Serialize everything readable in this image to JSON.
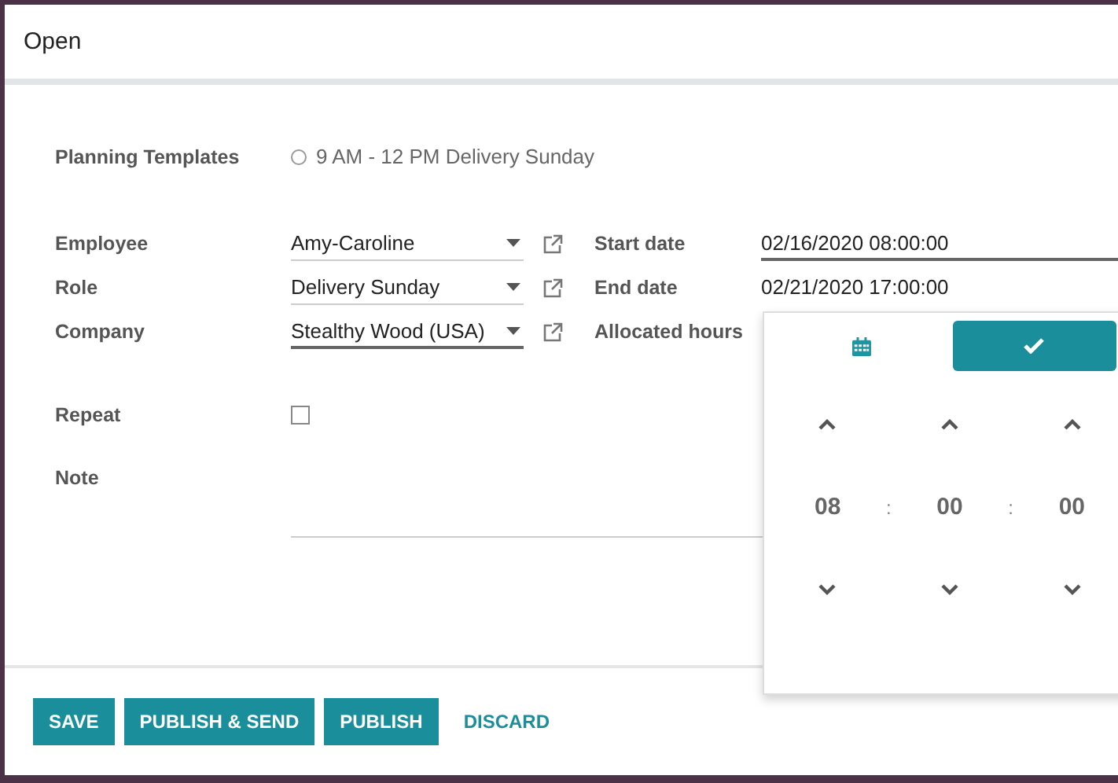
{
  "dialog": {
    "title": "Open"
  },
  "planning_templates": {
    "label": "Planning Templates",
    "options": [
      {
        "label": "9 AM - 12 PM Delivery Sunday",
        "selected": false
      }
    ]
  },
  "left_fields": [
    {
      "label": "Employee",
      "value": "Amy-Caroline",
      "focused": false
    },
    {
      "label": "Role",
      "value": "Delivery Sunday",
      "focused": false
    },
    {
      "label": "Company",
      "value": "Stealthy Wood (USA)",
      "focused": true
    }
  ],
  "right_fields": [
    {
      "label": "Start date",
      "value": "02/16/2020 08:00:00",
      "focused": true
    },
    {
      "label": "End date",
      "value": "02/21/2020 17:00:00",
      "focused": false
    },
    {
      "label": "Allocated hours"
    }
  ],
  "repeat": {
    "label": "Repeat",
    "checked": false
  },
  "note": {
    "label": "Note"
  },
  "time_picker": {
    "hour": "08",
    "minute": "00",
    "second": "00",
    "separators": [
      ":",
      ":"
    ]
  },
  "buttons": [
    {
      "label": "SAVE",
      "kind": "primary"
    },
    {
      "label": "PUBLISH & SEND",
      "kind": "primary"
    },
    {
      "label": "PUBLISH",
      "kind": "primary"
    },
    {
      "label": "DISCARD",
      "kind": "link"
    }
  ]
}
